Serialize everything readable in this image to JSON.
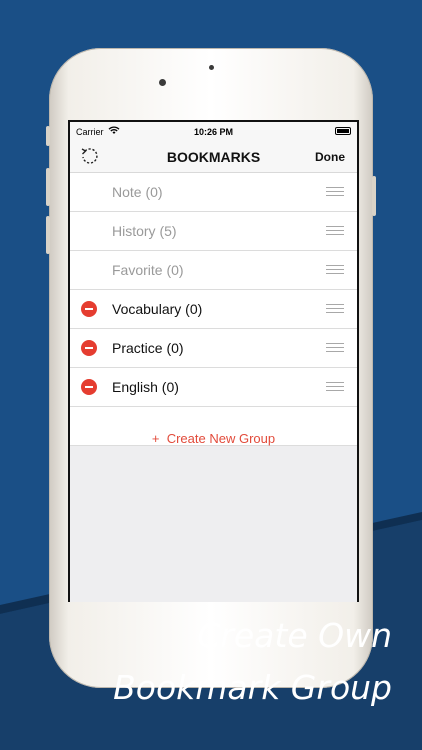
{
  "status_bar": {
    "carrier": "Carrier",
    "wifi_icon": "wifi-icon",
    "time": "10:26 PM",
    "battery_icon": "battery-icon"
  },
  "nav": {
    "title": "BOOKMARKS",
    "done_label": "Done",
    "refresh_icon": "refresh-icon"
  },
  "groups": [
    {
      "label": "Note (0)",
      "deletable": false
    },
    {
      "label": "History (5)",
      "deletable": false
    },
    {
      "label": "Favorite (0)",
      "deletable": false
    },
    {
      "label": "Vocabulary (0)",
      "deletable": true
    },
    {
      "label": "Practice (0)",
      "deletable": true
    },
    {
      "label": "English (0)",
      "deletable": true
    }
  ],
  "create_group": {
    "plus": "+",
    "label": "Create New Group"
  },
  "caption": {
    "line1": "Create Own",
    "line2": "Bookmark Group"
  },
  "colors": {
    "background": "#1a4f86",
    "delete_red": "#e53d30",
    "create_red": "#e24b3b"
  }
}
